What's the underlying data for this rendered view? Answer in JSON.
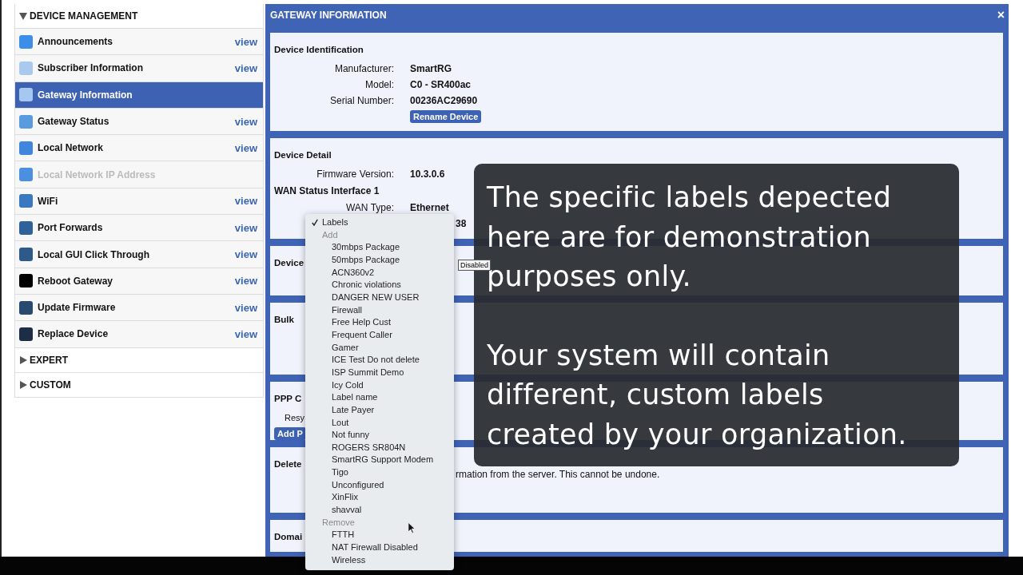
{
  "sidebar": {
    "groups": [
      {
        "title": "DEVICE MANAGEMENT",
        "expanded": true,
        "items": [
          {
            "label": "Announcements",
            "color": "#3d8ee8",
            "selected": false,
            "disabled": false,
            "action": "view"
          },
          {
            "label": "Subscriber Information",
            "color": "#a9c9ee",
            "selected": false,
            "disabled": false,
            "action": "view"
          },
          {
            "label": "Gateway Information",
            "color": "#a6c8f0",
            "selected": true,
            "disabled": false
          },
          {
            "label": "Gateway Status",
            "color": "#5a9be0",
            "selected": false,
            "disabled": false,
            "action": "view"
          },
          {
            "label": "Local Network",
            "color": "#3f86dc",
            "selected": false,
            "disabled": false,
            "action": "view"
          },
          {
            "label": "Local Network IP Address",
            "color": "#4a8fe0",
            "selected": false,
            "disabled": true
          },
          {
            "label": "WiFi",
            "color": "#3a78c0",
            "selected": false,
            "disabled": false,
            "action": "view"
          },
          {
            "label": "Port Forwards",
            "color": "#30629a",
            "selected": false,
            "disabled": false,
            "action": "view"
          },
          {
            "label": "Local GUI Click Through",
            "color": "#2e5a8a",
            "selected": false,
            "disabled": false,
            "action": "view"
          },
          {
            "label": "Reboot Gateway",
            "color": "#000000",
            "selected": false,
            "disabled": false,
            "action": "view"
          },
          {
            "label": "Update Firmware",
            "color": "#284a6e",
            "selected": false,
            "disabled": false,
            "action": "view"
          },
          {
            "label": "Replace Device",
            "color": "#1c2d45",
            "selected": false,
            "disabled": false,
            "action": "view"
          }
        ]
      },
      {
        "title": "EXPERT",
        "expanded": false
      },
      {
        "title": "CUSTOM",
        "expanded": false
      }
    ]
  },
  "panel": {
    "title": "GATEWAY INFORMATION",
    "close": "×",
    "sections": [
      {
        "heading": "Device Identification",
        "rows": [
          {
            "kind": "field",
            "label": "Manufacturer:",
            "value": "SmartRG"
          },
          {
            "kind": "field",
            "label": "Model:",
            "value": "C0 - SR400ac"
          },
          {
            "kind": "field",
            "label": "Serial Number:",
            "value": "00236AC29690"
          }
        ],
        "button": "Rename Device"
      },
      {
        "heading": "Device Detail",
        "rows": [
          {
            "kind": "field",
            "label": "Firmware Version:",
            "value": "10.3.0.6"
          },
          {
            "kind": "subheading",
            "label": "WAN Status Interface 1"
          },
          {
            "kind": "field",
            "label": "WAN Type:",
            "value": "Ethernet"
          },
          {
            "kind": "partial",
            "value": "38"
          }
        ]
      },
      {
        "heading": "Device",
        "small_button": "Disabled"
      },
      {
        "heading": "Bulk"
      },
      {
        "heading": "PPP C",
        "rows": [
          {
            "kind": "cut_label",
            "label": "Resy"
          }
        ],
        "button": "Add P"
      },
      {
        "heading": "Delete",
        "note": "rmation from the server. This cannot be undone."
      },
      {
        "heading": "Domai"
      }
    ]
  },
  "menu": {
    "title": "Labels",
    "checked": true,
    "groups": [
      {
        "heading": "Add",
        "items": [
          "30mbps Package",
          "50mbps Package",
          "ACN360v2",
          "Chronic violations",
          "DANGER NEW USER",
          "Firewall",
          "Free Help Cust",
          "Frequent Caller",
          "Gamer",
          "ICE Test Do not delete",
          "ISP Summit Demo",
          "Icy Cold",
          "Label name",
          "Late Payer",
          "Lout",
          "Not funny",
          "ROGERS SR804N",
          "SmartRG Support Modem",
          "Tigo",
          "Unconfigured",
          "XinFlix",
          "shavval"
        ]
      },
      {
        "heading": "Remove",
        "items": [
          "FTTH",
          "NAT Firewall Disabled",
          "Wireless"
        ]
      }
    ]
  },
  "caption": {
    "paragraphs": [
      "The specific labels depected here are for demonstration purposes only.",
      "Your system will contain different, custom labels created by your organization."
    ]
  }
}
